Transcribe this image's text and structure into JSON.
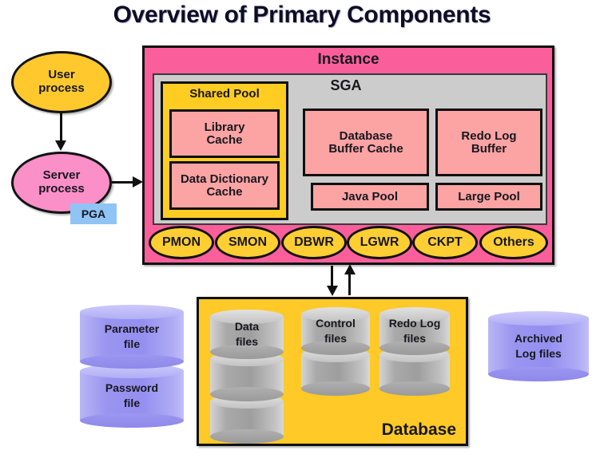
{
  "title": "Overview of Primary Components",
  "colors": {
    "instance_pink": "#FA5F9B",
    "sga_gray": "#CCCCCC",
    "shared_pool_gold": "#FFCC22",
    "component_salmon": "#FCA3A3",
    "database_gold": "#FFC928",
    "user_process_gold": "#FFC92E",
    "server_process_pink": "#FB8FC8",
    "pga_blue": "#8FC4F5",
    "bg_process_gold": "#FFCE33",
    "cylinder_gray": "#A9A9A9",
    "cylinder_purple": "#948FF0",
    "outline_black": "#101010"
  },
  "left_processes": {
    "user_process": "User\nprocess",
    "user_process_line1": "User",
    "user_process_line2": "process",
    "server_process_line1": "Server",
    "server_process_line2": "process",
    "pga": "PGA"
  },
  "instance": {
    "label": "Instance",
    "sga": {
      "label": "SGA",
      "shared_pool": {
        "label": "Shared Pool",
        "items": [
          {
            "line1": "Library",
            "line2": "Cache"
          },
          {
            "line1": "Data Dictionary",
            "line2": "Cache"
          }
        ]
      },
      "buffers": [
        {
          "name": "database-buffer-cache",
          "line1": "Database",
          "line2": "Buffer Cache"
        },
        {
          "name": "redo-log-buffer",
          "line1": "Redo Log",
          "line2": "Buffer"
        }
      ],
      "pools": [
        {
          "name": "java-pool",
          "label": "Java Pool"
        },
        {
          "name": "large-pool",
          "label": "Large Pool"
        }
      ]
    },
    "background_processes": [
      {
        "name": "pmon",
        "label": "PMON"
      },
      {
        "name": "smon",
        "label": "SMON"
      },
      {
        "name": "dbwr",
        "label": "DBWR"
      },
      {
        "name": "lgwr",
        "label": "LGWR"
      },
      {
        "name": "ckpt",
        "label": "CKPT"
      },
      {
        "name": "others",
        "label": "Others"
      }
    ]
  },
  "database": {
    "label": "Database",
    "file_groups": [
      {
        "name": "data-files",
        "line1": "Data",
        "line2": "files",
        "stack_count": 3
      },
      {
        "name": "control-files",
        "line1": "Control",
        "line2": "files",
        "stack_count": 2
      },
      {
        "name": "redo-log-files",
        "line1": "Redo Log",
        "line2": "files",
        "stack_count": 2
      }
    ]
  },
  "external_files": {
    "parameter_file": {
      "line1": "Parameter",
      "line2": "file"
    },
    "password_file": {
      "line1": "Password",
      "line2": "file"
    },
    "archived_log_files": {
      "line1": "Archived",
      "line2": "Log files"
    }
  }
}
